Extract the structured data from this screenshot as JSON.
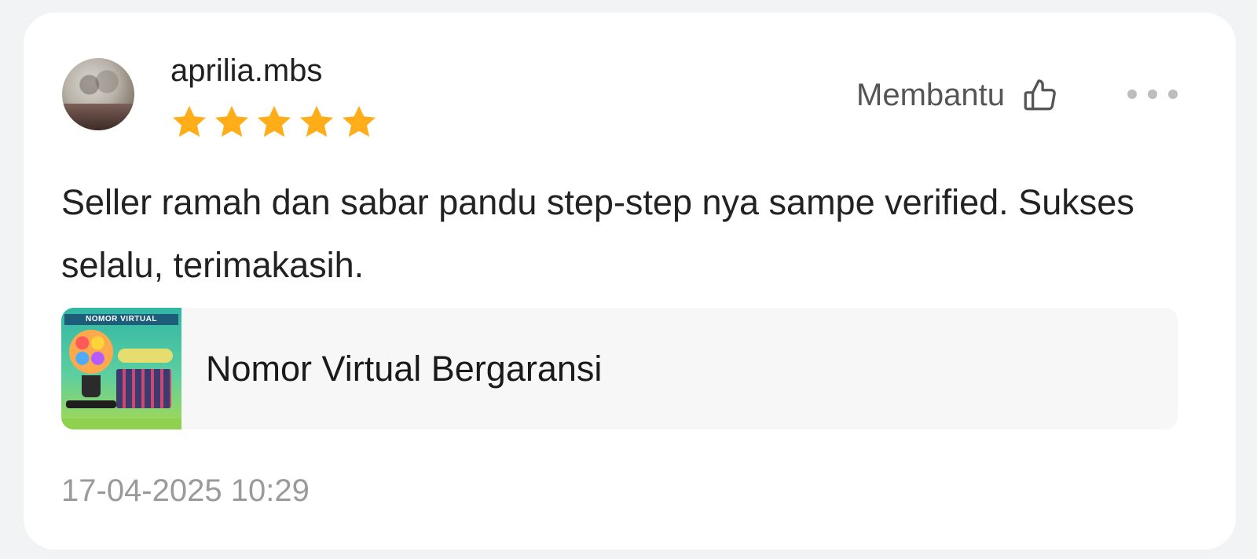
{
  "review": {
    "username": "aprilia.mbs",
    "rating": 5,
    "rating_max": 5,
    "helpful_label": "Membantu",
    "text": "Seller ramah dan sabar pandu step-step nya sampe verified. Sukses selalu, terimakasih.",
    "timestamp": "17-04-2025 10:29"
  },
  "product": {
    "title": "Nomor Virtual Bergaransi",
    "thumbnail_banner": "NOMOR VIRTUAL"
  },
  "icons": {
    "helpful": "thumbs-up-icon",
    "more": "more-options-icon",
    "star": "star-icon"
  },
  "colors": {
    "star": "#ffae1a",
    "background": "#f2f3f4",
    "card": "#ffffff",
    "muted_text": "#9a9a9a"
  }
}
